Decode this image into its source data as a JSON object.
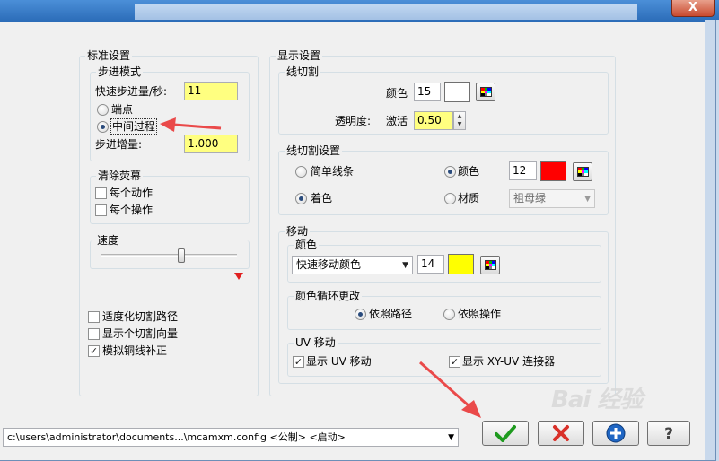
{
  "window": {
    "close_label": "X"
  },
  "standard": {
    "title": "标准设置",
    "step_mode": {
      "title": "步进模式",
      "fast_label": "快速步进量/秒:",
      "fast_value": "11",
      "endpoint_label": "端点",
      "midpoint_label": "中间过程",
      "increment_label": "步进增量:",
      "increment_value": "1.000"
    },
    "clear": {
      "title": "清除荧幕",
      "each_action_label": "每个动作",
      "each_op_label": "每个操作"
    },
    "speed": {
      "title": "速度",
      "level": 0.6
    },
    "options": {
      "adaptive_label": "适度化切割路径",
      "show_vector_label": "显示个切割向量",
      "wire_comp_label": "模拟铜线补正"
    }
  },
  "display": {
    "title": "显示设置",
    "wire_cut": {
      "title": "线切割",
      "color_label": "颜色",
      "color_value": "15",
      "transparency_label": "透明度:",
      "activate_label": "激活",
      "transparency_value": "0.50"
    },
    "wire_settings": {
      "title": "线切割设置",
      "simple_lines_label": "简单线条",
      "color_label": "颜色",
      "color_value": "12",
      "shaded_label": "着色",
      "material_label": "材质",
      "material_value": "祖母绿"
    },
    "move": {
      "title": "移动",
      "color": {
        "title": "颜色",
        "select_value": "快速移动颜色",
        "value": "14"
      },
      "cycle": {
        "title": "颜色循环更改",
        "by_path_label": "依照路径",
        "by_op_label": "依照操作"
      },
      "uv": {
        "title": "UV 移动",
        "show_uv_label": "显示 UV 移动",
        "show_xyuv_label": "显示 XY-UV 连接器"
      }
    }
  },
  "footer": {
    "path_value": "c:\\users\\administrator\\documents...\\mcamxm.config <公制> <启动>"
  },
  "colors": {
    "input_yellow": "#ffff80",
    "swatch_white": "#ffffff",
    "swatch_red": "#ff0000",
    "swatch_yellow": "#ffff00",
    "annotation_red": "#ea4a4a"
  },
  "watermark": "Bai 经验"
}
